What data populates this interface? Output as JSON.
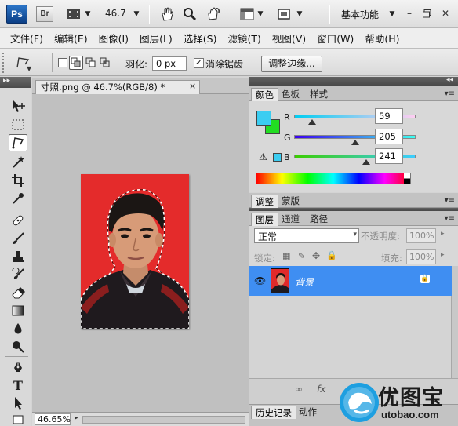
{
  "appbar": {
    "ps_logo": "Ps",
    "br_logo": "Br",
    "zoom": "46.7",
    "workspace": "基本功能"
  },
  "menu": [
    "文件(F)",
    "编辑(E)",
    "图像(I)",
    "图层(L)",
    "选择(S)",
    "滤镜(T)",
    "视图(V)",
    "窗口(W)",
    "帮助(H)"
  ],
  "options": {
    "feather_label": "羽化:",
    "feather_value": "0 px",
    "antialias_label": "消除锯齿",
    "antialias_checked": "✓",
    "refine_edge_label": "调整边缘..."
  },
  "document": {
    "tab_title": "寸照.png @ 46.7%(RGB/8) *",
    "close": "×",
    "zoom_status": "46.65%"
  },
  "color_panel": {
    "tabs": [
      "颜色",
      "色板",
      "样式"
    ],
    "r_label": "R",
    "g_label": "G",
    "b_label": "B",
    "r": "59",
    "g": "205",
    "b": "241",
    "fg_color": "#3bcdf1",
    "bg_color": "#22dd22"
  },
  "adjust_panel": {
    "tabs": [
      "调整",
      "蒙版"
    ]
  },
  "layers_panel": {
    "tabs": [
      "图层",
      "通道",
      "路径"
    ],
    "blend_mode": "正常",
    "opacity_label": "不透明度:",
    "opacity_value": "100%",
    "lock_label": "锁定:",
    "fill_label": "填充:",
    "fill_value": "100%",
    "layer_name": "背景"
  },
  "bottom_tabs": [
    "历史记录",
    "动作"
  ],
  "watermark": {
    "name": "优图宝",
    "url": "utobao.com"
  }
}
